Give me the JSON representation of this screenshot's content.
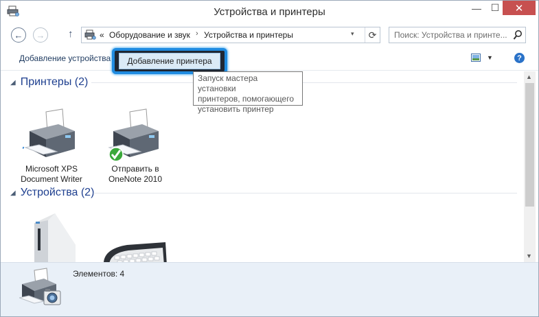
{
  "window": {
    "title": "Устройства и принтеры"
  },
  "titlebar": {
    "minimize_glyph": "—",
    "maximize_glyph": "☐",
    "close_glyph": "✕"
  },
  "nav": {
    "back_glyph": "←",
    "forward_glyph": "→",
    "up_glyph": "↑",
    "address": {
      "prefix": "«",
      "segments": [
        "Оборудование и звук",
        "Устройства и принтеры"
      ],
      "separator": "›"
    },
    "refresh_glyph": "⟳",
    "dropdown_glyph": "▾",
    "search": {
      "placeholder": "Поиск: Устройства и принте..."
    }
  },
  "commandbar": {
    "add_device": "Добавление устройства",
    "add_printer": "Добавление принтера",
    "view_dropdown_glyph": "▼",
    "help_glyph": "?"
  },
  "tooltip": {
    "lines": [
      "Запуск мастера установки",
      "принтеров, помогающего",
      "установить принтер"
    ]
  },
  "groups": {
    "printers": {
      "title": "Принтеры (2)",
      "items": [
        {
          "label_lines": [
            "Microsoft XPS",
            "Document Writer"
          ],
          "icon": "printer-icon"
        },
        {
          "label_lines": [
            "Отправить в",
            "OneNote 2010"
          ],
          "icon": "printer-default-icon"
        }
      ]
    },
    "devices": {
      "title": "Устройства (2)",
      "items": [
        {
          "icon": "computer-icon"
        },
        {
          "icon": "keyboard-icon"
        }
      ]
    }
  },
  "scrollbar": {
    "up_glyph": "▲",
    "down_glyph": "▼"
  },
  "details": {
    "count_text": "Элементов: 4"
  },
  "colors": {
    "accent_highlight": "#1f8be0",
    "group_title": "#1e3f8f",
    "close_button": "#c75050",
    "details_bg": "#e9f0f8"
  }
}
